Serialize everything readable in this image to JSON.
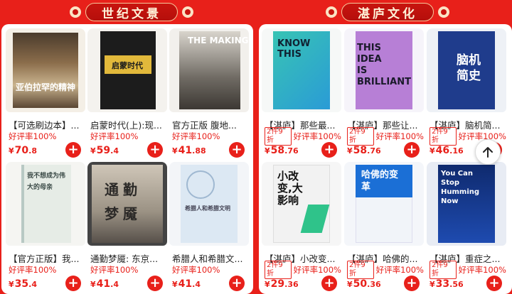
{
  "sections": {
    "left_title": "世纪文景",
    "right_title": "湛庐文化"
  },
  "products_left": [
    {
      "title": "【可选刷边本】...",
      "rating": "好评率100%",
      "price_int": "70",
      "price_frac": ".8",
      "promo": "",
      "cover_text": "亚伯拉罕的精神"
    },
    {
      "title": "启蒙时代(上):现...",
      "rating": "好评率100%",
      "price_int": "59",
      "price_frac": ".4",
      "promo": "",
      "cover_text": "启蒙时代"
    },
    {
      "title": "官方正版 腹地...",
      "rating": "好评率100%",
      "price_int": "41",
      "price_frac": ".88",
      "promo": "",
      "cover_text": "THE MAKING"
    },
    {
      "title": "【官方正版】我...",
      "rating": "好评率100%",
      "price_int": "35",
      "price_frac": ".4",
      "promo": "",
      "cover_text": "我不想成为伟大的母亲"
    },
    {
      "title": "通勤梦魇: 东京...",
      "rating": "好评率100%",
      "price_int": "41",
      "price_frac": ".4",
      "promo": "",
      "cover_text": "通勤梦魇"
    },
    {
      "title": "希腊人和希腊文...",
      "rating": "好评率100%",
      "price_int": "41",
      "price_frac": ".4",
      "promo": "",
      "cover_text": "希腊人和希腊文明"
    }
  ],
  "products_right": [
    {
      "title": "【湛庐】那些最...",
      "rating": "好评率100%",
      "price_int": "58",
      "price_frac": ".76",
      "promo": "2件9折",
      "cover_text": "KNOW THIS"
    },
    {
      "title": "【湛庐】那些让...",
      "rating": "好评率100%",
      "price_int": "58",
      "price_frac": ".76",
      "promo": "2件9折",
      "cover_text": "THIS IDEA IS BRILLIANT"
    },
    {
      "title": "【湛庐】脑机简...",
      "rating": "好评率100%",
      "price_int": "46",
      "price_frac": ".16",
      "promo": "2件9折",
      "cover_text": "脑机简史"
    },
    {
      "title": "【湛庐】小改变...",
      "rating": "好评率100%",
      "price_int": "29",
      "price_frac": ".36",
      "promo": "2件9折",
      "cover_text": "小改变,大影响"
    },
    {
      "title": "【湛庐】哈佛的...",
      "rating": "好评率100%",
      "price_int": "50",
      "price_frac": ".36",
      "promo": "2件9折",
      "cover_text": "哈佛的变革"
    },
    {
      "title": "【湛庐】重症之...",
      "rating": "好评率100%",
      "price_int": "33",
      "price_frac": ".56",
      "promo": "2件9折",
      "cover_text": "You Can Stop Humming Now"
    }
  ],
  "currency": "¥",
  "add_symbol": "+",
  "colors": {
    "brand_red": "#e8201a"
  },
  "icons": {
    "scroll_top": "arrow-up-icon"
  }
}
